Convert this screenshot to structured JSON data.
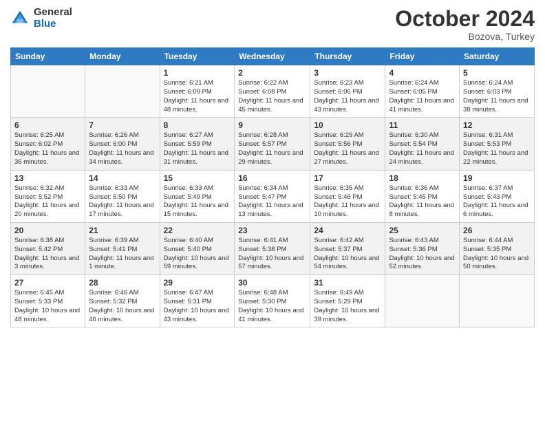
{
  "logo": {
    "general": "General",
    "blue": "Blue"
  },
  "title": "October 2024",
  "subtitle": "Bozova, Turkey",
  "days_of_week": [
    "Sunday",
    "Monday",
    "Tuesday",
    "Wednesday",
    "Thursday",
    "Friday",
    "Saturday"
  ],
  "weeks": [
    [
      {
        "day": "",
        "info": ""
      },
      {
        "day": "",
        "info": ""
      },
      {
        "day": "1",
        "info": "Sunrise: 6:21 AM\nSunset: 6:09 PM\nDaylight: 11 hours and 48 minutes."
      },
      {
        "day": "2",
        "info": "Sunrise: 6:22 AM\nSunset: 6:08 PM\nDaylight: 11 hours and 45 minutes."
      },
      {
        "day": "3",
        "info": "Sunrise: 6:23 AM\nSunset: 6:06 PM\nDaylight: 11 hours and 43 minutes."
      },
      {
        "day": "4",
        "info": "Sunrise: 6:24 AM\nSunset: 6:05 PM\nDaylight: 11 hours and 41 minutes."
      },
      {
        "day": "5",
        "info": "Sunrise: 6:24 AM\nSunset: 6:03 PM\nDaylight: 11 hours and 38 minutes."
      }
    ],
    [
      {
        "day": "6",
        "info": "Sunrise: 6:25 AM\nSunset: 6:02 PM\nDaylight: 11 hours and 36 minutes."
      },
      {
        "day": "7",
        "info": "Sunrise: 6:26 AM\nSunset: 6:00 PM\nDaylight: 11 hours and 34 minutes."
      },
      {
        "day": "8",
        "info": "Sunrise: 6:27 AM\nSunset: 5:59 PM\nDaylight: 11 hours and 31 minutes."
      },
      {
        "day": "9",
        "info": "Sunrise: 6:28 AM\nSunset: 5:57 PM\nDaylight: 11 hours and 29 minutes."
      },
      {
        "day": "10",
        "info": "Sunrise: 6:29 AM\nSunset: 5:56 PM\nDaylight: 11 hours and 27 minutes."
      },
      {
        "day": "11",
        "info": "Sunrise: 6:30 AM\nSunset: 5:54 PM\nDaylight: 11 hours and 24 minutes."
      },
      {
        "day": "12",
        "info": "Sunrise: 6:31 AM\nSunset: 5:53 PM\nDaylight: 11 hours and 22 minutes."
      }
    ],
    [
      {
        "day": "13",
        "info": "Sunrise: 6:32 AM\nSunset: 5:52 PM\nDaylight: 11 hours and 20 minutes."
      },
      {
        "day": "14",
        "info": "Sunrise: 6:33 AM\nSunset: 5:50 PM\nDaylight: 11 hours and 17 minutes."
      },
      {
        "day": "15",
        "info": "Sunrise: 6:33 AM\nSunset: 5:49 PM\nDaylight: 11 hours and 15 minutes."
      },
      {
        "day": "16",
        "info": "Sunrise: 6:34 AM\nSunset: 5:47 PM\nDaylight: 11 hours and 13 minutes."
      },
      {
        "day": "17",
        "info": "Sunrise: 6:35 AM\nSunset: 5:46 PM\nDaylight: 11 hours and 10 minutes."
      },
      {
        "day": "18",
        "info": "Sunrise: 6:36 AM\nSunset: 5:45 PM\nDaylight: 11 hours and 8 minutes."
      },
      {
        "day": "19",
        "info": "Sunrise: 6:37 AM\nSunset: 5:43 PM\nDaylight: 11 hours and 6 minutes."
      }
    ],
    [
      {
        "day": "20",
        "info": "Sunrise: 6:38 AM\nSunset: 5:42 PM\nDaylight: 11 hours and 3 minutes."
      },
      {
        "day": "21",
        "info": "Sunrise: 6:39 AM\nSunset: 5:41 PM\nDaylight: 11 hours and 1 minute."
      },
      {
        "day": "22",
        "info": "Sunrise: 6:40 AM\nSunset: 5:40 PM\nDaylight: 10 hours and 59 minutes."
      },
      {
        "day": "23",
        "info": "Sunrise: 6:41 AM\nSunset: 5:38 PM\nDaylight: 10 hours and 57 minutes."
      },
      {
        "day": "24",
        "info": "Sunrise: 6:42 AM\nSunset: 5:37 PM\nDaylight: 10 hours and 54 minutes."
      },
      {
        "day": "25",
        "info": "Sunrise: 6:43 AM\nSunset: 5:36 PM\nDaylight: 10 hours and 52 minutes."
      },
      {
        "day": "26",
        "info": "Sunrise: 6:44 AM\nSunset: 5:35 PM\nDaylight: 10 hours and 50 minutes."
      }
    ],
    [
      {
        "day": "27",
        "info": "Sunrise: 6:45 AM\nSunset: 5:33 PM\nDaylight: 10 hours and 48 minutes."
      },
      {
        "day": "28",
        "info": "Sunrise: 6:46 AM\nSunset: 5:32 PM\nDaylight: 10 hours and 46 minutes."
      },
      {
        "day": "29",
        "info": "Sunrise: 6:47 AM\nSunset: 5:31 PM\nDaylight: 10 hours and 43 minutes."
      },
      {
        "day": "30",
        "info": "Sunrise: 6:48 AM\nSunset: 5:30 PM\nDaylight: 10 hours and 41 minutes."
      },
      {
        "day": "31",
        "info": "Sunrise: 6:49 AM\nSunset: 5:29 PM\nDaylight: 10 hours and 39 minutes."
      },
      {
        "day": "",
        "info": ""
      },
      {
        "day": "",
        "info": ""
      }
    ]
  ]
}
